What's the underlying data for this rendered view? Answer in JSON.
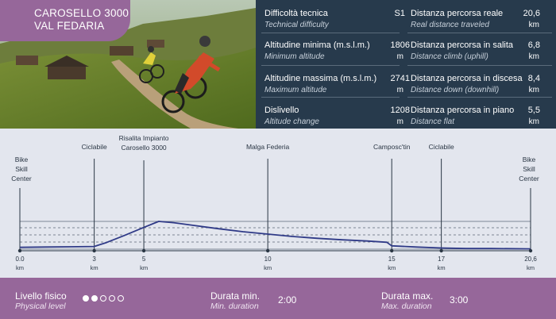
{
  "route": {
    "title_line1": "CAROSELLO 3000",
    "title_line2": "VAL FEDARIA"
  },
  "stats": {
    "left": [
      {
        "label": "Difficoltà tecnica",
        "sub": "Technical difficulty",
        "value": "S1",
        "unit": ""
      },
      {
        "label": "Altitudine minima (m.s.l.m.)",
        "sub": "Minimum altitude",
        "value": "1806",
        "unit": "m"
      },
      {
        "label": "Altitudine massima (m.s.l.m.)",
        "sub": "Maximum altitude",
        "value": "2741",
        "unit": "m"
      },
      {
        "label": "Dislivello",
        "sub": "Altitude change",
        "value": "1208",
        "unit": "m"
      }
    ],
    "right": [
      {
        "label": "Distanza percorsa reale",
        "sub": "Real distance traveled",
        "value": "20,6",
        "unit": "km"
      },
      {
        "label": "Distanza percorsa in salita",
        "sub": "Distance climb (uphill)",
        "value": "6,8",
        "unit": "km"
      },
      {
        "label": "Distanza percorsa in discesa",
        "sub": "Distance down (downhill)",
        "value": "8,4",
        "unit": "km"
      },
      {
        "label": "Distanza percorsa in piano",
        "sub": "Distance flat",
        "value": "5,5",
        "unit": "km"
      }
    ]
  },
  "profile": {
    "waypoints": [
      {
        "km": 0,
        "lines": [
          "Bike",
          "Skill",
          "Center"
        ]
      },
      {
        "km": 3,
        "lines": [
          "Ciclabile"
        ]
      },
      {
        "km": 5,
        "lines": [
          "Risalita Impianto",
          "Carosello 3000"
        ]
      },
      {
        "km": 10,
        "lines": [
          "Malga Federia"
        ]
      },
      {
        "km": 15,
        "lines": [
          "Camposc'tin"
        ]
      },
      {
        "km": 17,
        "lines": [
          "Ciclabile"
        ]
      },
      {
        "km": 20.6,
        "lines": [
          "Bike",
          "Skill",
          "Center"
        ]
      }
    ],
    "ticks": [
      {
        "km": 0,
        "label": "0.0"
      },
      {
        "km": 3,
        "label": "3"
      },
      {
        "km": 5,
        "label": "5"
      },
      {
        "km": 10,
        "label": "10"
      },
      {
        "km": 15,
        "label": "15"
      },
      {
        "km": 17,
        "label": "17"
      },
      {
        "km": 20.6,
        "label": "20,6"
      }
    ],
    "unit": "km",
    "total_km": 20.6,
    "relative_elevation": [
      [
        0,
        0.06
      ],
      [
        1,
        0.07
      ],
      [
        2,
        0.08
      ],
      [
        3,
        0.09
      ],
      [
        3.5,
        0.22
      ],
      [
        4.2,
        0.45
      ],
      [
        5,
        0.72
      ],
      [
        5.6,
        0.92
      ],
      [
        6.2,
        0.88
      ],
      [
        7,
        0.79
      ],
      [
        8,
        0.68
      ],
      [
        9,
        0.58
      ],
      [
        10,
        0.5
      ],
      [
        11,
        0.42
      ],
      [
        12,
        0.36
      ],
      [
        13,
        0.31
      ],
      [
        14,
        0.27
      ],
      [
        14.8,
        0.23
      ],
      [
        15,
        0.11
      ],
      [
        16,
        0.07
      ],
      [
        17,
        0.04
      ],
      [
        18,
        0.02
      ],
      [
        19,
        0.02
      ],
      [
        20.6,
        0.01
      ]
    ],
    "line_color": "#2f3a87"
  },
  "footer": {
    "physical_label": "Livello fisico",
    "physical_sub": "Physical level",
    "physical_level": 2,
    "physical_max": 5,
    "min_label": "Durata min.",
    "min_sub": "Min. duration",
    "min_value": "2:00",
    "max_label": "Durata max.",
    "max_sub": "Max. duration",
    "max_value": "3:00"
  },
  "colors": {
    "purple": "#96679a",
    "navy": "#273a4c",
    "profile_bg": "#e3e6ee"
  }
}
